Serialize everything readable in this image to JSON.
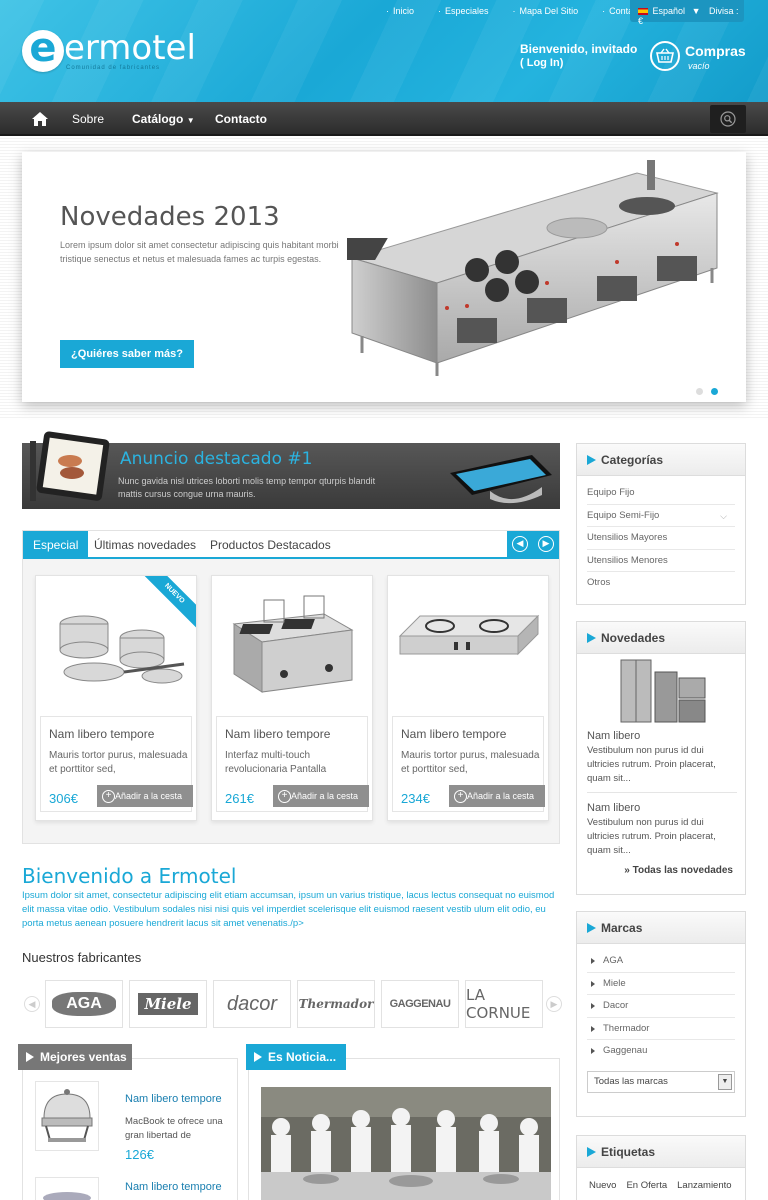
{
  "header": {
    "top_links": [
      "Inicio",
      "Especiales",
      "Mapa Del Sitio",
      "Contacto"
    ],
    "language": "Español",
    "currency": "Divisa : €",
    "logo_text": "ermotel",
    "logo_letter": "e",
    "logo_tagline": "Comunidad de fabricantes",
    "welcome": "Bienvenido, invitado",
    "login": "( Log In)",
    "cart_title": "Compras",
    "cart_status": "vacío"
  },
  "nav": {
    "items": [
      "Sobre",
      "Catálogo",
      "Contacto"
    ]
  },
  "slider": {
    "title": "Novedades 2013",
    "text": "Lorem ipsum dolor sit amet consectetur adipiscing quis habitant morbi tristique senectus et netus et malesuada fames ac turpis egestas.",
    "button": "¿Quiéres saber más?",
    "dot_count": 2,
    "active_dot": 2
  },
  "ad": {
    "title": "Anuncio destacado #1",
    "text": "Nunc gavida nisl utrices loborti molis temp tempor qturpis blandit mattis cursus congue urna mauris."
  },
  "tabs": {
    "items": [
      "Especial",
      "Últimas novedades",
      "Productos Destacados"
    ],
    "active": 0
  },
  "products": [
    {
      "name": "Nam libero tempore",
      "desc": "Mauris tortor purus, malesuada et porttitor sed,",
      "price": "306€",
      "button": "Añadir a la cesta",
      "badge": "NUEVO"
    },
    {
      "name": "Nam libero tempore",
      "desc": "Interfaz multi-touch revolucionaria Pantalla",
      "price": "261€",
      "button": "Añadir a la cesta"
    },
    {
      "name": "Nam libero tempore",
      "desc": "Mauris tortor purus, malesuada et porttitor sed,",
      "price": "234€",
      "button": "Añadir a la cesta"
    }
  ],
  "welcome_block": {
    "title": "Bienvenido a Ermotel",
    "text": "Ipsum dolor sit amet, consectetur adipiscing elit etiam accumsan, ipsum un varius tristique, lacus lectus consequat no euismod elit massa vitae odio. Vestibulum sodales nisi nisi quis vel imperdiet scelerisque elit euismod raesent vestib ulum elit odio, eu porta metus aenean posuere hendrerit lacus sit amet venenatis./p>"
  },
  "manufacturers": {
    "title": "Nuestros fabricantes",
    "logos": [
      "AGA",
      "Miele",
      "dacor",
      "Thermador",
      "GAGGENAU",
      "LA CORNUE"
    ]
  },
  "best_sellers": {
    "title": "Mejores ventas",
    "items": [
      {
        "name": "Nam libero tempore",
        "desc": "MacBook te ofrece una gran libertad de",
        "price": "126€"
      },
      {
        "name": "Nam libero tempore"
      }
    ]
  },
  "news": {
    "title": "Es Noticia..."
  },
  "sidebar": {
    "categories": {
      "title": "Categorías",
      "items": [
        "Equipo Fijo",
        "Equipo Semi-Fijo",
        "Utensilios Mayores",
        "Utensilios Menores",
        "Otros"
      ]
    },
    "novedades": {
      "title": "Novedades",
      "items": [
        {
          "name": "Nam libero",
          "text": "Vestibulum non purus id dui ultricies rutrum. Proin placerat, quam sit..."
        },
        {
          "name": "Nam libero",
          "text": "Vestibulum non purus id dui ultricies rutrum. Proin placerat, quam sit..."
        }
      ],
      "all_link": "» Todas las novedades"
    },
    "marcas": {
      "title": "Marcas",
      "items": [
        "AGA",
        "Miele",
        "Dacor",
        "Thermador",
        "Gaggenau"
      ],
      "select": "Todas las marcas"
    },
    "etiquetas": {
      "title": "Etiquetas",
      "items": [
        "Nuevo",
        "En Oferta",
        "Lanzamiento"
      ]
    }
  },
  "colors": {
    "accent": "#1aa8d6",
    "nav_bg": "#333333",
    "ad_bg": "#4a4a4a",
    "button_gray": "#8f8f8f"
  }
}
